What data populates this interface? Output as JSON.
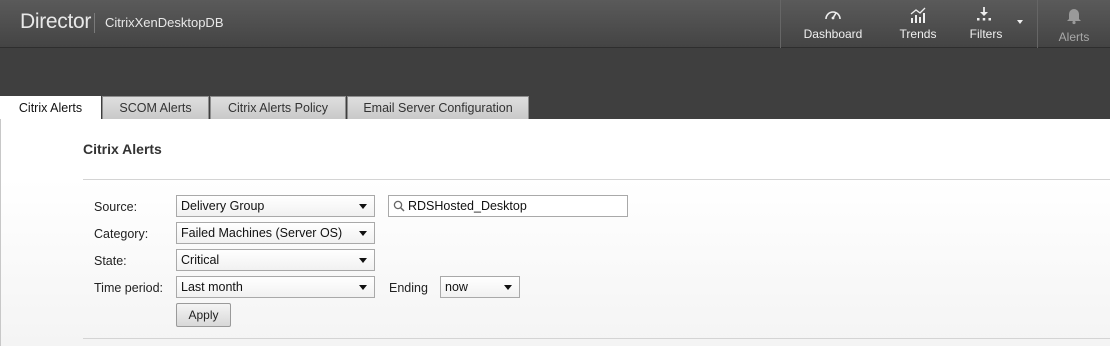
{
  "header": {
    "app_name": "Director",
    "site_name": "CitrixXenDesktopDB",
    "nav": [
      {
        "label": "Dashboard",
        "icon": "dashboard-gauge-icon"
      },
      {
        "label": "Trends",
        "icon": "trends-chart-icon"
      },
      {
        "label": "Filters",
        "icon": "filters-icon"
      },
      {
        "label": "Alerts",
        "icon": "bell-icon",
        "disabled": true
      }
    ]
  },
  "tabs": [
    {
      "label": "Citrix Alerts",
      "active": true
    },
    {
      "label": "SCOM Alerts",
      "active": false
    },
    {
      "label": "Citrix Alerts Policy",
      "active": false
    },
    {
      "label": "Email Server Configuration",
      "active": false
    }
  ],
  "main": {
    "title": "Citrix Alerts",
    "form": {
      "source_label": "Source:",
      "source_value": "Delivery Group",
      "search_value": "RDSHosted_Desktop",
      "category_label": "Category:",
      "category_value": "Failed Machines (Server OS)",
      "state_label": "State:",
      "state_value": "Critical",
      "period_label": "Time period:",
      "period_value": "Last month",
      "ending_label": "Ending",
      "ending_value": "now",
      "apply_label": "Apply"
    }
  },
  "colors": {
    "topbar": "#4d4d4d",
    "band": "#3f3f3f",
    "tab_inactive": "#d4d4d4"
  }
}
